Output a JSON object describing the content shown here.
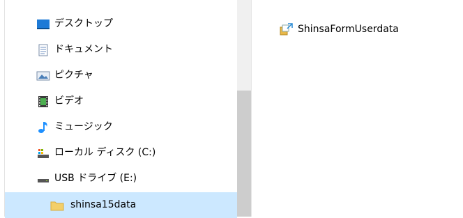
{
  "nav": {
    "items": [
      {
        "label": "デスクトップ",
        "icon": "desktop-icon"
      },
      {
        "label": "ドキュメント",
        "icon": "document-icon"
      },
      {
        "label": "ピクチャ",
        "icon": "picture-icon"
      },
      {
        "label": "ビデオ",
        "icon": "video-icon"
      },
      {
        "label": "ミュージック",
        "icon": "music-icon"
      },
      {
        "label": "ローカル ディスク (C:)",
        "icon": "local-disk-icon"
      },
      {
        "label": "USB ドライブ (E:)",
        "icon": "usb-drive-icon"
      },
      {
        "label": "shinsa15data",
        "icon": "folder-icon"
      }
    ],
    "selected_index": 7
  },
  "content": {
    "files": [
      {
        "label": "ShinsaFormUserdata",
        "icon": "shortcut-package-icon"
      }
    ]
  },
  "colors": {
    "selection": "#cce8ff",
    "scrollbar_track": "#f0f0f0",
    "scrollbar_thumb": "#cdcdcd",
    "desktop_icon": "#1e7ad6",
    "folder_icon": "#f3cf6a",
    "music_icon": "#1e90ff"
  }
}
